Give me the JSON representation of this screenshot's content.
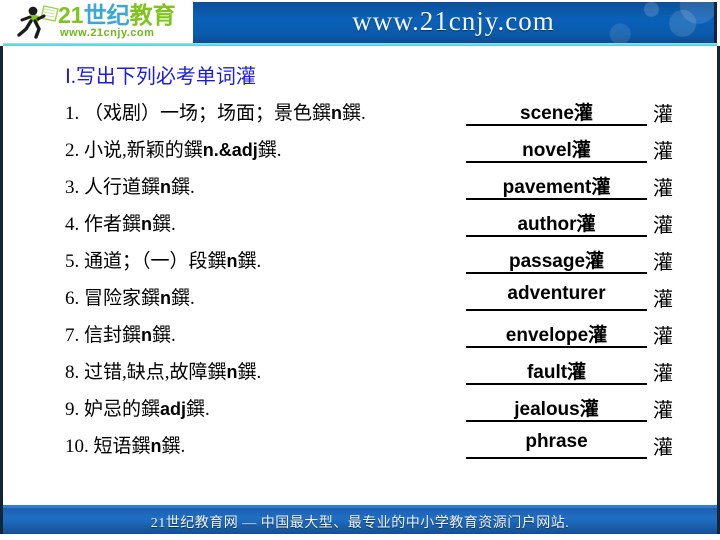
{
  "header": {
    "logo": {
      "icon": "running-person-with-book-icon",
      "text_21": "21",
      "text_cn": "世纪",
      "text_edu": "教育",
      "sub": "www.21cnjy.com"
    },
    "banner_url": "www.21cnjy.com"
  },
  "colors": {
    "banner_blue": "#0a5bab",
    "footer_blue": "#1f6fc4",
    "title_blue": "#1c1ce0",
    "rule_cyan": "#4ecfe0",
    "logo_green": "#7fc41d",
    "logo_cyan": "#3aa7d8",
    "page_border": "#14253a"
  },
  "main": {
    "title": "Ⅰ.写出下列必考单词灌",
    "items": [
      {
        "number": "1.",
        "chinese": "（戏剧）一场；场面；景色鐉",
        "pos": "n",
        "tail": "鐉.",
        "answer": "scene",
        "answer_moji": "灌",
        "trailing_moji": "灌"
      },
      {
        "number": "2.",
        "chinese": "小说,新颖的鐉",
        "pos": "n.&adj",
        "tail": "鐉.",
        "answer": "novel",
        "answer_moji": "灌",
        "trailing_moji": "灌"
      },
      {
        "number": "3.",
        "chinese": "人行道鐉",
        "pos": "n",
        "tail": "鐉.",
        "answer": "pavement",
        "answer_moji": "灌",
        "trailing_moji": "灌"
      },
      {
        "number": "4.",
        "chinese": "作者鐉",
        "pos": "n",
        "tail": "鐉.",
        "answer": "author",
        "answer_moji": "灌",
        "trailing_moji": "灌"
      },
      {
        "number": "5.",
        "chinese": "通道；（一）段鐉",
        "pos": "n",
        "tail": "鐉.",
        "answer": "passage",
        "answer_moji": "灌",
        "trailing_moji": "灌"
      },
      {
        "number": "6.",
        "chinese": "冒险家鐉",
        "pos": "n",
        "tail": "鐉.",
        "answer": "adventurer",
        "answer_moji": "",
        "trailing_moji": "灌"
      },
      {
        "number": "7.",
        "chinese": "信封鐉",
        "pos": "n",
        "tail": "鐉.",
        "answer": "envelope",
        "answer_moji": "灌",
        "trailing_moji": "灌"
      },
      {
        "number": "8.",
        "chinese": "过错,缺点,故障鐉",
        "pos": "n",
        "tail": "鐉.",
        "answer": "fault",
        "answer_moji": "灌",
        "trailing_moji": "灌"
      },
      {
        "number": "9.",
        "chinese": "妒忌的鐉",
        "pos": "adj",
        "tail": "鐉.",
        "answer": "jealous",
        "answer_moji": "灌",
        "trailing_moji": "灌"
      },
      {
        "number": "10.",
        "chinese": "短语鐉",
        "pos": "n",
        "tail": "鐉.",
        "answer": "phrase",
        "answer_moji": "",
        "trailing_moji": "灌"
      }
    ]
  },
  "footer": {
    "text": "21世纪教育网 — 中国最大型、最专业的中小学教育资源门户网站."
  }
}
